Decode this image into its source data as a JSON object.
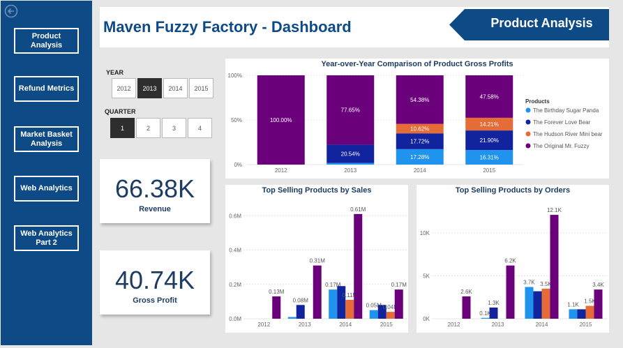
{
  "sidebar": {
    "back_icon": "circle-arrow-left-icon",
    "items": [
      {
        "label": "Product Analysis"
      },
      {
        "label": "Refund Metrics"
      },
      {
        "label": "Market Basket\nAnalysis"
      },
      {
        "label": "Web Analytics"
      },
      {
        "label": "Web Analytics\nPart 2"
      }
    ]
  },
  "header": {
    "title": "Maven Fuzzy Factory - Dashboard",
    "page_label": "Product Analysis"
  },
  "slicers": {
    "year_label": "YEAR",
    "years": [
      "2012",
      "2013",
      "2014",
      "2015"
    ],
    "selected_year": "2013",
    "quarter_label": "QUARTER",
    "quarters": [
      "1",
      "2",
      "3",
      "4"
    ],
    "selected_quarter": "1"
  },
  "kpis": [
    {
      "value": "66.38K",
      "label": "Revenue"
    },
    {
      "value": "40.74K",
      "label": "Gross Profit"
    }
  ],
  "colors": {
    "sidebar": "#0e4a86",
    "birthday_sugar_panda": "#1f93ee",
    "forever_love_bear": "#12239e",
    "hudson_river_mini_bear": "#e66c37",
    "original_mr_fuzzy": "#6b007b"
  },
  "chart_data": [
    {
      "type": "bar",
      "stacked": "percent",
      "title": "Year-over-Year Comparison of Product Gross Profits",
      "categories": [
        "2012",
        "2013",
        "2014",
        "2015"
      ],
      "yticks": [
        "0%",
        "50%",
        "100%"
      ],
      "legend_title": "Products",
      "legend_position": "right",
      "series": [
        {
          "name": "The Birthday Sugar Panda",
          "values": [
            0,
            1.81,
            17.28,
            16.31
          ],
          "labels": [
            "",
            "",
            "17.28%",
            "16.31%"
          ]
        },
        {
          "name": "The Forever Love Bear",
          "values": [
            0,
            20.54,
            17.72,
            21.9
          ],
          "labels": [
            "",
            "20.54%",
            "17.72%",
            "21.90%"
          ]
        },
        {
          "name": "The Hudson River Mini bear",
          "values": [
            0,
            0,
            10.62,
            14.21
          ],
          "labels": [
            "",
            "",
            "10.62%",
            "14.21%"
          ]
        },
        {
          "name": "The Original Mr. Fuzzy",
          "values": [
            100.0,
            77.65,
            54.38,
            47.58
          ],
          "labels": [
            "100.00%",
            "77.65%",
            "54.38%",
            "47.58%"
          ]
        }
      ]
    },
    {
      "type": "bar",
      "title": "Top Selling Products by Sales",
      "categories": [
        "2012",
        "2013",
        "2014",
        "2015"
      ],
      "ylim": [
        0,
        0.65
      ],
      "yticks": [
        "0.0M",
        "0.2M",
        "0.4M",
        "0.6M"
      ],
      "series": [
        {
          "name": "The Birthday Sugar Panda",
          "values": [
            0,
            0.01,
            0.17,
            0.05
          ],
          "labels": [
            "",
            "",
            "0.17M",
            "0.05M"
          ]
        },
        {
          "name": "The Forever Love Bear",
          "values": [
            0,
            0.08,
            0.19,
            0.08
          ],
          "labels": [
            "",
            "0.08M",
            "",
            ""
          ]
        },
        {
          "name": "The Hudson River Mini bear",
          "values": [
            0,
            0,
            0.11,
            0.04
          ],
          "labels": [
            "",
            "",
            "0.11M",
            "0.04M"
          ]
        },
        {
          "name": "The Original Mr. Fuzzy",
          "values": [
            0.13,
            0.31,
            0.61,
            0.17
          ],
          "labels": [
            "0.13M",
            "0.31M",
            "0.61M",
            "0.17M"
          ]
        }
      ]
    },
    {
      "type": "bar",
      "title": "Top Selling Products by Orders",
      "categories": [
        "2012",
        "2013",
        "2014",
        "2015"
      ],
      "ylim": [
        0,
        13000
      ],
      "yticks": [
        "0K",
        "5K",
        "10K"
      ],
      "series": [
        {
          "name": "The Birthday Sugar Panda",
          "values": [
            0,
            100,
            3700,
            1100
          ],
          "labels": [
            "",
            "0.1K",
            "3.7K",
            "1.1K"
          ]
        },
        {
          "name": "The Forever Love Bear",
          "values": [
            0,
            1300,
            3200,
            1100
          ],
          "labels": [
            "",
            "1.3K",
            "",
            ""
          ]
        },
        {
          "name": "The Hudson River Mini bear",
          "values": [
            0,
            0,
            3500,
            1500
          ],
          "labels": [
            "",
            "",
            "3.5K",
            "1.5K"
          ]
        },
        {
          "name": "The Original Mr. Fuzzy",
          "values": [
            2600,
            6200,
            12100,
            3400
          ],
          "labels": [
            "2.6K",
            "6.2K",
            "12.1K",
            "3.4K"
          ]
        }
      ]
    }
  ]
}
